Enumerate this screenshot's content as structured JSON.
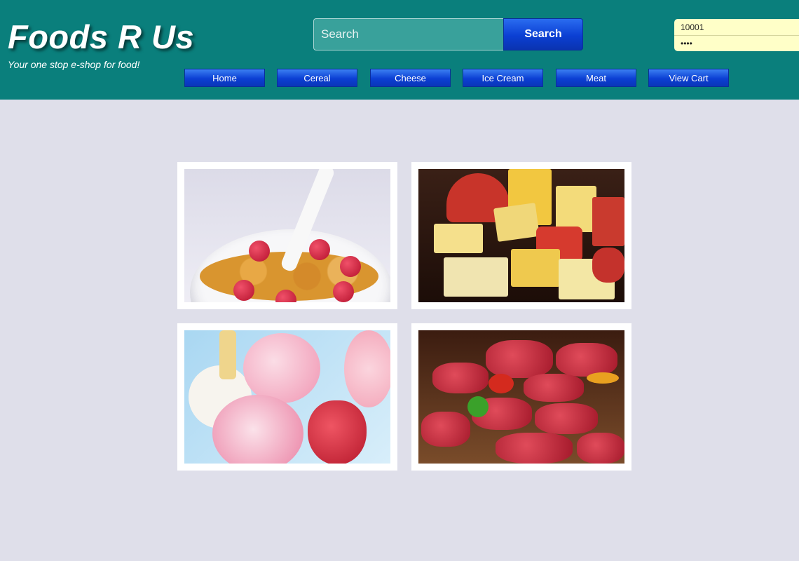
{
  "brand": {
    "title": "Foods R Us",
    "tagline": "Your one stop e-shop for food!"
  },
  "search": {
    "placeholder": "Search",
    "button_label": "Search"
  },
  "login": {
    "username_value": "10001",
    "password_value": "••••"
  },
  "nav": {
    "items": [
      {
        "label": "Home"
      },
      {
        "label": "Cereal"
      },
      {
        "label": "Cheese"
      },
      {
        "label": "Ice Cream"
      },
      {
        "label": "Meat"
      },
      {
        "label": "View Cart"
      }
    ]
  },
  "gallery": {
    "tiles": [
      {
        "category": "Cereal",
        "image": "cereal-image"
      },
      {
        "category": "Cheese",
        "image": "cheese-image"
      },
      {
        "category": "Ice Cream",
        "image": "ice-cream-image"
      },
      {
        "category": "Meat",
        "image": "meat-image"
      }
    ]
  },
  "colors": {
    "header_bg": "#0a7f7c",
    "page_bg": "#dfdfea",
    "button_blue": "#0b3fd3",
    "login_bg": "#ffffc8"
  }
}
